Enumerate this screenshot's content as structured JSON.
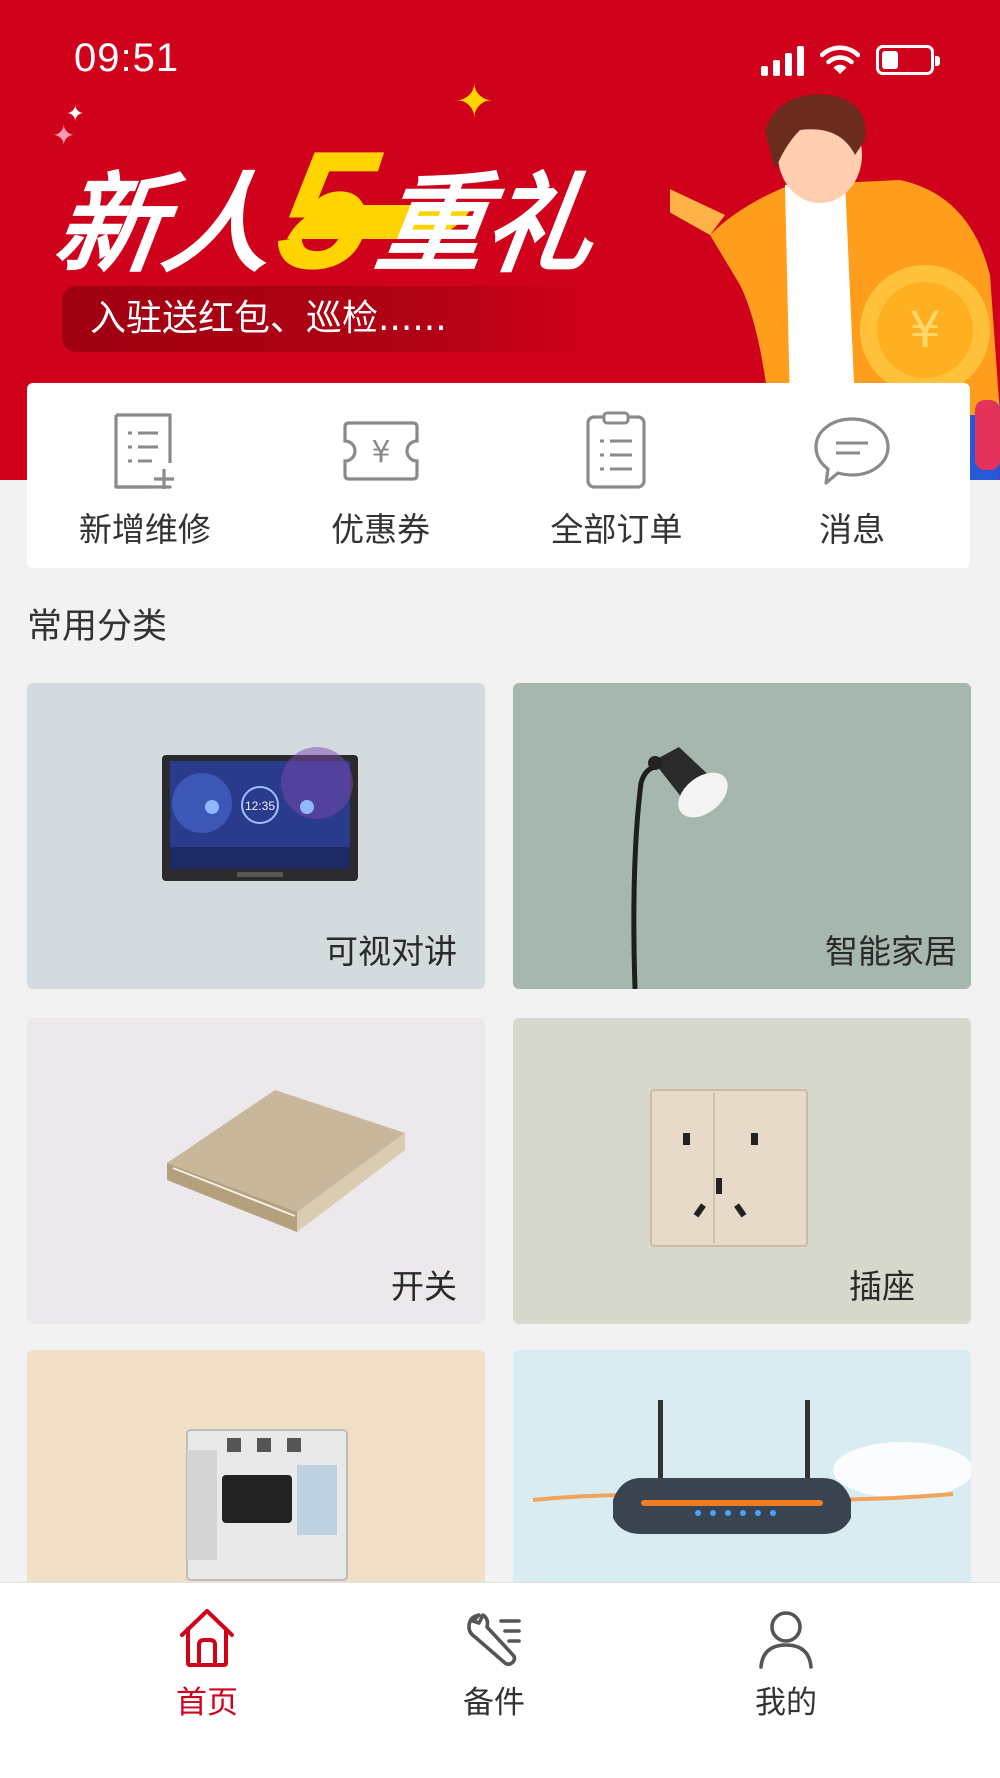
{
  "status_bar": {
    "time": "09:51",
    "battery_level": 0.35
  },
  "banner": {
    "title_part1": "新人",
    "title_number": "5",
    "title_part2": "重礼",
    "subtitle": "入驻送红包、巡检......",
    "colors": {
      "background": "#d0011b",
      "accent": "#ffd400"
    }
  },
  "quick_actions": [
    {
      "label": "新增维修",
      "icon": "add-repair-document-icon"
    },
    {
      "label": "优惠券",
      "icon": "coupon-yen-icon"
    },
    {
      "label": "全部订单",
      "icon": "clipboard-orders-icon"
    },
    {
      "label": "消息",
      "icon": "chat-bubble-icon"
    }
  ],
  "categories_section": {
    "title": "常用分类",
    "items": [
      {
        "label": "可视对讲",
        "image": "video-intercom-panel"
      },
      {
        "label": "智能家居",
        "image": "floor-lamp"
      },
      {
        "label": "开关",
        "image": "wall-switch"
      },
      {
        "label": "插座",
        "image": "wall-socket"
      },
      {
        "label": "",
        "image": "circuit-breaker"
      },
      {
        "label": "",
        "image": "wifi-router"
      }
    ]
  },
  "tab_bar": {
    "active": "首页",
    "active_color": "#d0011b",
    "tabs": [
      {
        "label": "首页",
        "icon": "home-icon"
      },
      {
        "label": "备件",
        "icon": "wrench-icon"
      },
      {
        "label": "我的",
        "icon": "user-icon"
      }
    ]
  }
}
